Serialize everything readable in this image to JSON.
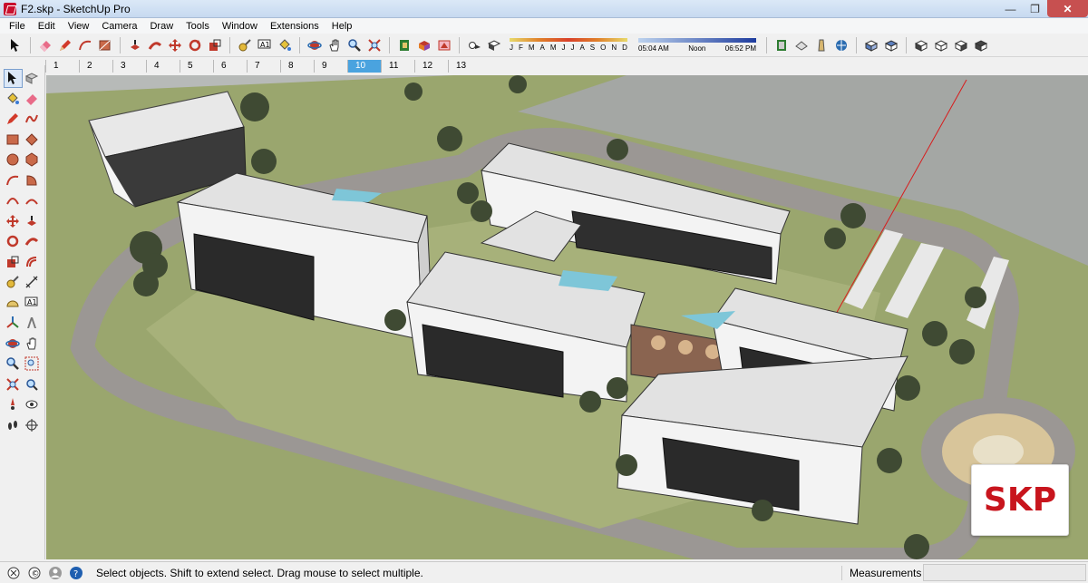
{
  "window": {
    "title": "F2.skp - SketchUp Pro"
  },
  "menu": [
    "File",
    "Edit",
    "View",
    "Camera",
    "Draw",
    "Tools",
    "Window",
    "Extensions",
    "Help"
  ],
  "shadows": {
    "months": [
      "J",
      "F",
      "M",
      "A",
      "M",
      "J",
      "J",
      "A",
      "S",
      "O",
      "N",
      "D"
    ],
    "time_start": "05:04 AM",
    "time_mid": "Noon",
    "time_end": "06:52 PM"
  },
  "scenes": {
    "tabs": [
      "1",
      "2",
      "3",
      "4",
      "5",
      "6",
      "7",
      "8",
      "9",
      "10",
      "11",
      "12",
      "13"
    ],
    "active": "10"
  },
  "toolbar_icons": [
    "select-icon",
    "eraser-icon",
    "pencil-icon",
    "arc-icon",
    "shape-icon",
    "push-pull-icon",
    "follow-me-icon",
    "move-icon",
    "rotate-icon",
    "scale-icon",
    "tape-measure-icon",
    "text-icon",
    "paint-bucket-icon",
    "orbit-icon",
    "pan-icon",
    "zoom-icon",
    "zoom-extents-icon",
    "components-icon",
    "materials-icon",
    "styles-icon",
    "shadows-icon",
    "fog-icon",
    "warehouse-icon",
    "extension-icon",
    "section-icon",
    "3d-warehouse-icon",
    "iso-view-icon",
    "top-view-icon",
    "front-view-icon",
    "right-view-icon",
    "back-view-icon",
    "left-view-icon"
  ],
  "left_tools": [
    [
      "select-icon",
      "component-icon"
    ],
    [
      "paint-bucket-icon",
      "eraser-icon"
    ],
    [
      "line-icon",
      "freehand-icon"
    ],
    [
      "rectangle-icon",
      "rotated-rectangle-icon"
    ],
    [
      "circle-icon",
      "polygon-icon"
    ],
    [
      "arc-icon",
      "pie-icon"
    ],
    [
      "3pt-arc-icon",
      "2pt-arc-icon"
    ],
    [
      "move-icon",
      "push-pull-icon"
    ],
    [
      "rotate-icon",
      "follow-me-icon"
    ],
    [
      "scale-icon",
      "offset-icon"
    ],
    [
      "tape-measure-icon",
      "dimension-icon"
    ],
    [
      "protractor-icon",
      "text-icon"
    ],
    [
      "axes-icon",
      "3d-text-icon"
    ],
    [
      "orbit-icon",
      "pan-icon"
    ],
    [
      "zoom-icon",
      "zoom-window-icon"
    ],
    [
      "zoom-extents-icon",
      "previous-view-icon"
    ],
    [
      "position-camera-icon",
      "look-around-icon"
    ],
    [
      "walk-icon",
      "section-plane-icon"
    ]
  ],
  "badge": {
    "text": "SKP"
  },
  "status": {
    "message": "Select objects. Shift to extend select. Drag mouse to select multiple.",
    "measurements_label": "Measurements",
    "measurements_value": ""
  },
  "colors": {
    "ground": "#b7bab8",
    "lawn": "#9aa66e",
    "road": "#9b9794",
    "roof": "#e2e2e2",
    "brand": "#c8151d",
    "scene_active": "#4aa3df"
  }
}
